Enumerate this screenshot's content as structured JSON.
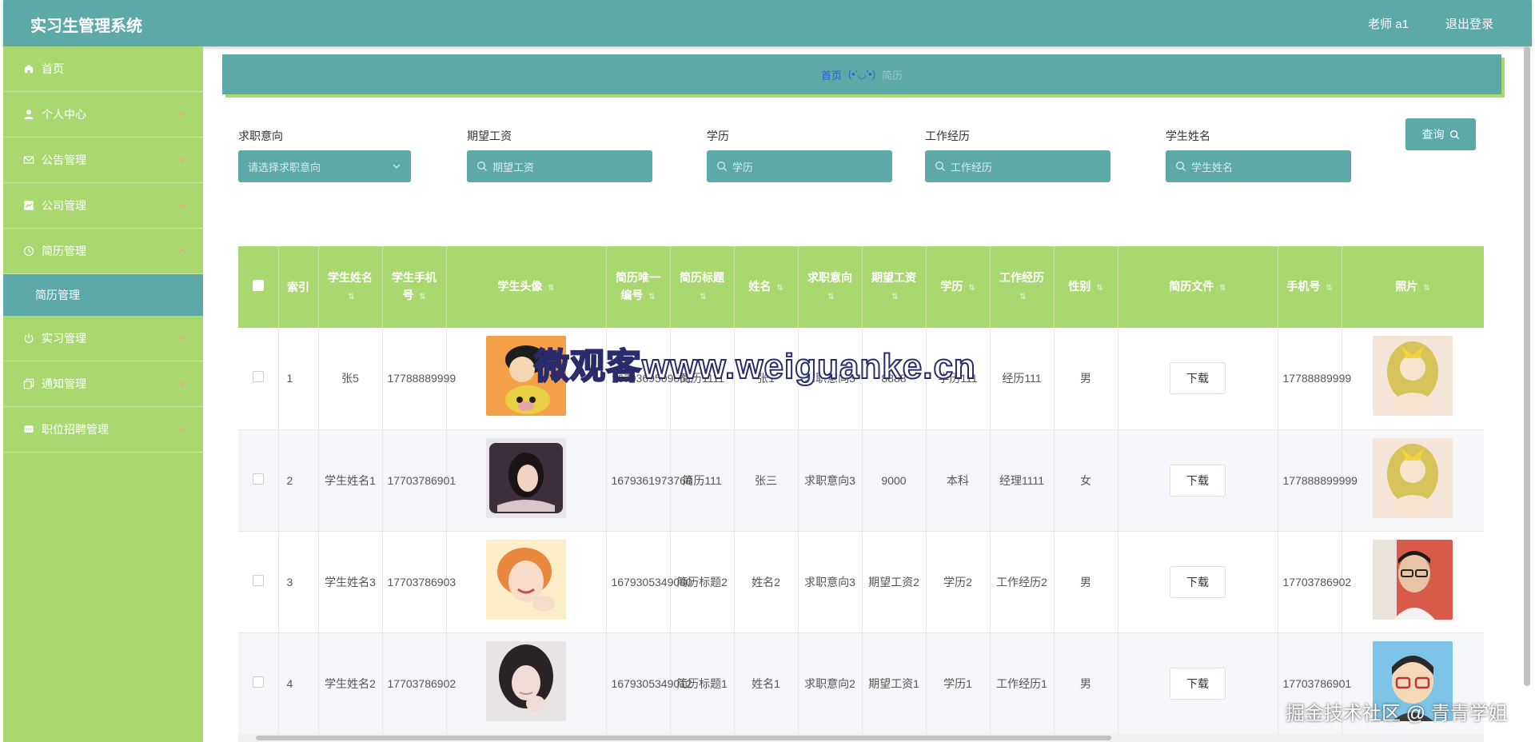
{
  "header": {
    "title": "实习生管理系统",
    "user": "老师 a1",
    "logout": "退出登录"
  },
  "sidebar": {
    "items": [
      {
        "label": "首页"
      },
      {
        "label": "个人中心"
      },
      {
        "label": "公告管理"
      },
      {
        "label": "公司管理"
      },
      {
        "label": "简历管理"
      },
      {
        "label": "实习管理"
      },
      {
        "label": "通知管理"
      },
      {
        "label": "职位招聘管理"
      }
    ],
    "sub_active": "简历管理"
  },
  "breadcrumb": {
    "home": "首页",
    "sep": "(•'◡'•)",
    "current": "简历"
  },
  "filters": {
    "f1_label": "求职意向",
    "f1_placeholder": "请选择求职意向",
    "f2_label": "期望工资",
    "f2_placeholder": "期望工资",
    "f3_label": "学历",
    "f3_placeholder": "学历",
    "f4_label": "工作经历",
    "f4_placeholder": "工作经历",
    "f5_label": "学生姓名",
    "f5_placeholder": "学生姓名",
    "query": "查询"
  },
  "table": {
    "headers": [
      "索引",
      "学生姓名",
      "学生手机号",
      "学生头像",
      "简历唯一编号",
      "简历标题",
      "姓名",
      "求职意向",
      "期望工资",
      "学历",
      "工作经历",
      "性别",
      "简历文件",
      "手机号",
      "照片"
    ],
    "download": "下载",
    "rows": [
      {
        "idx": "1",
        "sname": "张5",
        "sphone": "17788889999",
        "code": "1679369509061",
        "rtitle": "简历1111",
        "name": "张1",
        "intent": "求职意向3",
        "salary": "8888",
        "edu": "学历111",
        "exp": "经历111",
        "sex": "男",
        "phone": "17788889999"
      },
      {
        "idx": "2",
        "sname": "学生姓名1",
        "sphone": "17703786901",
        "code": "1679361973768",
        "rtitle": "简历111",
        "name": "张三",
        "intent": "求职意向3",
        "salary": "9000",
        "edu": "本科",
        "exp": "经理1111",
        "sex": "女",
        "phone": "177888899999"
      },
      {
        "idx": "3",
        "sname": "学生姓名3",
        "sphone": "17703786903",
        "code": "1679305349080",
        "rtitle": "简历标题2",
        "name": "姓名2",
        "intent": "求职意向3",
        "salary": "期望工资2",
        "edu": "学历2",
        "exp": "工作经历2",
        "sex": "男",
        "phone": "17703786902"
      },
      {
        "idx": "4",
        "sname": "学生姓名2",
        "sphone": "17703786902",
        "code": "1679305349012",
        "rtitle": "简历标题1",
        "name": "姓名1",
        "intent": "求职意向2",
        "salary": "期望工资1",
        "edu": "学历1",
        "exp": "工作经历1",
        "sex": "男",
        "phone": "17703786901"
      }
    ]
  },
  "watermarks": {
    "center": "微观客www.weiguanke.cn",
    "corner": "掘金技术社区 @ 青青学姐"
  },
  "colors": {
    "primary": "#5ca9a8",
    "green": "#a8d86f",
    "link": "#2f5bd6"
  }
}
